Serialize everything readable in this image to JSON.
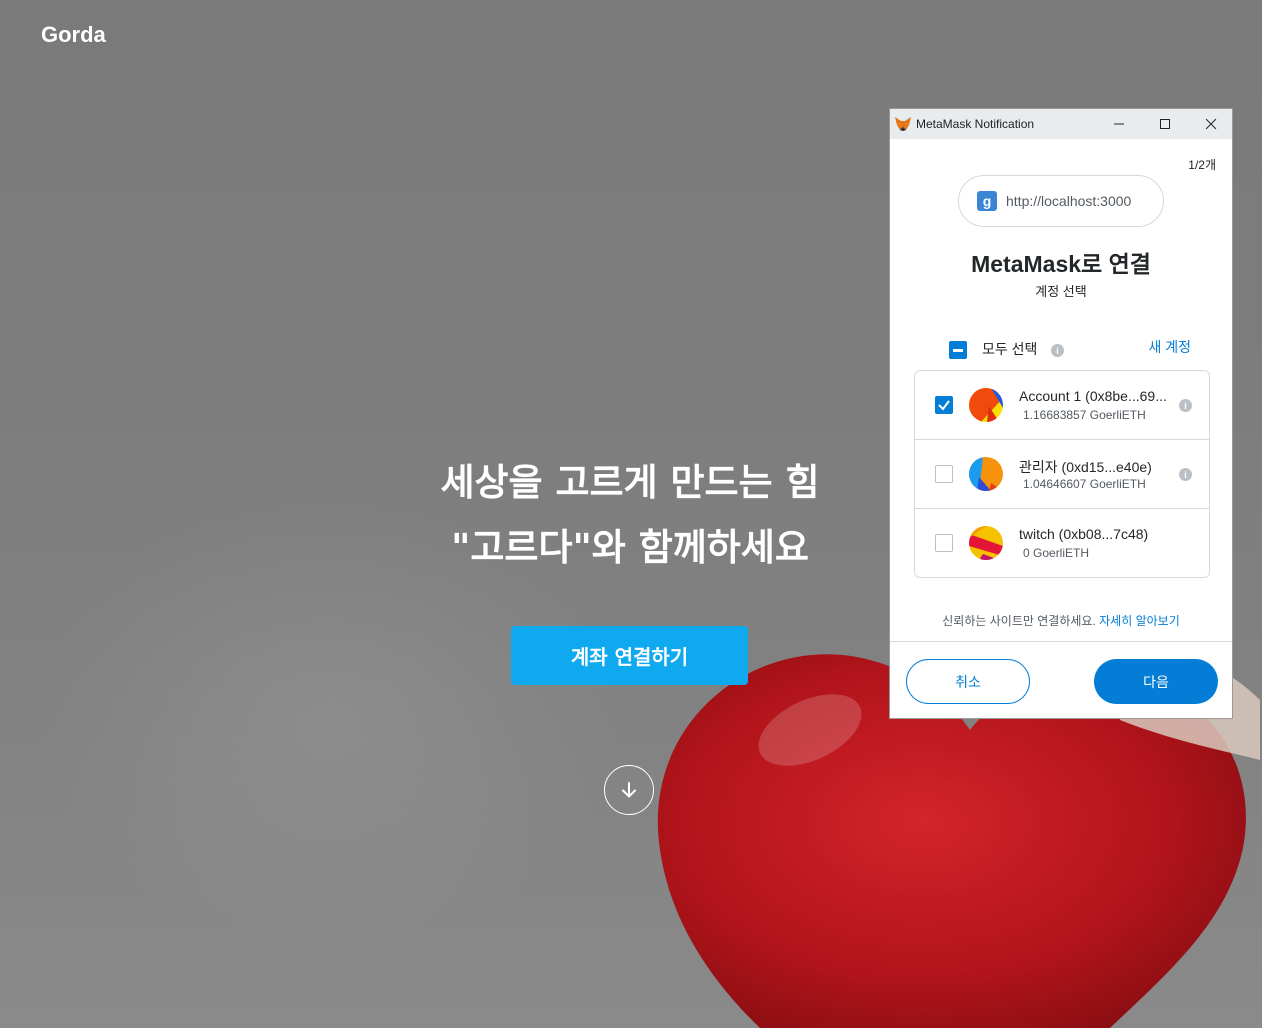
{
  "page": {
    "logo": "Gorda",
    "hero_line1": "세상을 고르게 만드는 힘",
    "hero_line2": "\"고르다\"와 함께하세요",
    "cta_label": "계좌 연결하기",
    "scroll_icon": "arrow-down-icon"
  },
  "metamask": {
    "window_title": "MetaMask Notification",
    "counter": "1/2개",
    "site_icon_letter": "g",
    "site_url": "http://localhost:3000",
    "heading": "MetaMask로 연결",
    "subheading": "계정 선택",
    "select_all_label": "모두 선택",
    "new_account_label": "새 계정",
    "accounts": [
      {
        "name": "Account 1 (0x8be...69...",
        "balance": "1.16683857 GoerliETH",
        "checked": true
      },
      {
        "name": "관리자 (0xd15...e40e)",
        "balance": "1.04646607 GoerliETH",
        "checked": false
      },
      {
        "name": "twitch (0xb08...7c48)",
        "balance": "0 GoerliETH",
        "checked": false
      }
    ],
    "trust_note": "신뢰하는 사이트만 연결하세요.",
    "learn_more": "자세히 알아보기",
    "cancel_label": "취소",
    "next_label": "다음"
  },
  "colors": {
    "accent": "#037dd6",
    "cta": "#0ea9ef",
    "heart": "#c0161a"
  }
}
